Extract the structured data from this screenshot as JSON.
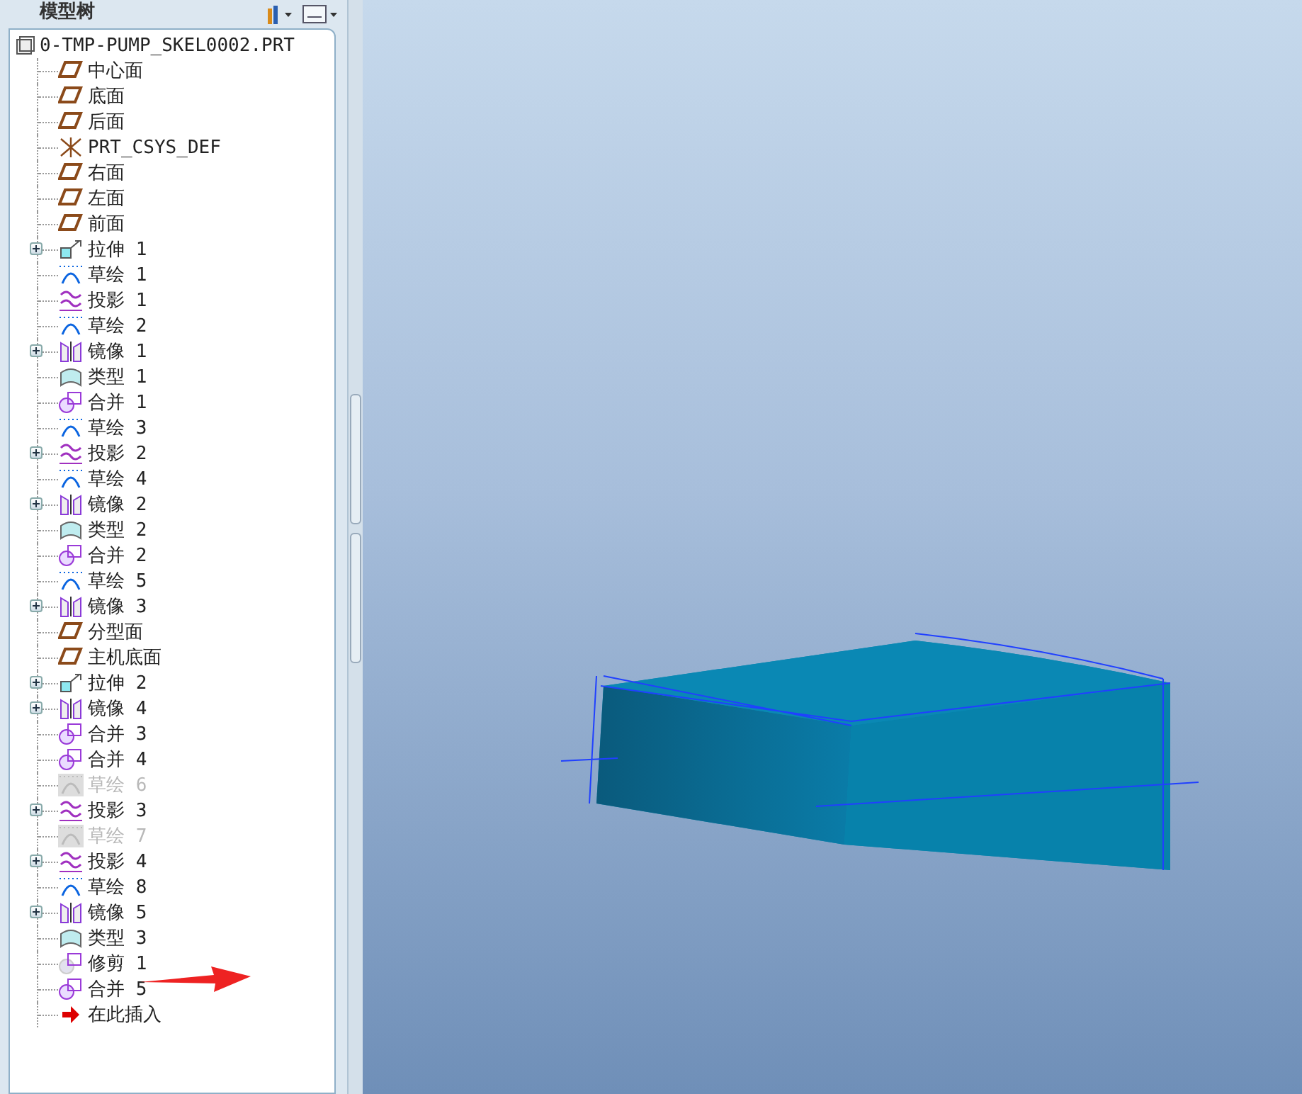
{
  "panel": {
    "title": "模型树"
  },
  "tree": {
    "root": {
      "label": "0-TMP-PUMP_SKEL0002.PRT"
    },
    "items": [
      {
        "kind": "plane",
        "label": "中心面",
        "collapsed": false,
        "suppressed": false
      },
      {
        "kind": "plane",
        "label": "底面",
        "collapsed": false,
        "suppressed": false
      },
      {
        "kind": "plane",
        "label": "后面",
        "collapsed": false,
        "suppressed": false
      },
      {
        "kind": "csys",
        "label": "PRT_CSYS_DEF",
        "collapsed": false,
        "suppressed": false
      },
      {
        "kind": "plane",
        "label": "右面",
        "collapsed": false,
        "suppressed": false
      },
      {
        "kind": "plane",
        "label": "左面",
        "collapsed": false,
        "suppressed": false
      },
      {
        "kind": "plane",
        "label": "前面",
        "collapsed": false,
        "suppressed": false
      },
      {
        "kind": "extrude",
        "label": "拉伸 1",
        "collapsed": true,
        "suppressed": false
      },
      {
        "kind": "sketch",
        "label": "草绘 1",
        "collapsed": false,
        "suppressed": false
      },
      {
        "kind": "projection",
        "label": "投影 1",
        "collapsed": false,
        "suppressed": false
      },
      {
        "kind": "sketch",
        "label": "草绘 2",
        "collapsed": false,
        "suppressed": false
      },
      {
        "kind": "mirror",
        "label": "镜像 1",
        "collapsed": true,
        "suppressed": false
      },
      {
        "kind": "style",
        "label": "类型 1",
        "collapsed": false,
        "suppressed": false
      },
      {
        "kind": "merge",
        "label": "合并 1",
        "collapsed": false,
        "suppressed": false
      },
      {
        "kind": "sketch",
        "label": "草绘 3",
        "collapsed": false,
        "suppressed": false
      },
      {
        "kind": "projection",
        "label": "投影 2",
        "collapsed": true,
        "suppressed": false
      },
      {
        "kind": "sketch",
        "label": "草绘 4",
        "collapsed": false,
        "suppressed": false
      },
      {
        "kind": "mirror",
        "label": "镜像 2",
        "collapsed": true,
        "suppressed": false
      },
      {
        "kind": "style",
        "label": "类型 2",
        "collapsed": false,
        "suppressed": false
      },
      {
        "kind": "merge",
        "label": "合并 2",
        "collapsed": false,
        "suppressed": false
      },
      {
        "kind": "sketch",
        "label": "草绘 5",
        "collapsed": false,
        "suppressed": false
      },
      {
        "kind": "mirror",
        "label": "镜像 3",
        "collapsed": true,
        "suppressed": false
      },
      {
        "kind": "plane",
        "label": "分型面",
        "collapsed": false,
        "suppressed": false
      },
      {
        "kind": "plane",
        "label": "主机底面",
        "collapsed": false,
        "suppressed": false
      },
      {
        "kind": "extrude",
        "label": "拉伸 2",
        "collapsed": true,
        "suppressed": false
      },
      {
        "kind": "mirror",
        "label": "镜像 4",
        "collapsed": true,
        "suppressed": false
      },
      {
        "kind": "merge",
        "label": "合并 3",
        "collapsed": false,
        "suppressed": false
      },
      {
        "kind": "merge",
        "label": "合并 4",
        "collapsed": false,
        "suppressed": false
      },
      {
        "kind": "sketch",
        "label": "草绘 6",
        "collapsed": false,
        "suppressed": true
      },
      {
        "kind": "projection",
        "label": "投影 3",
        "collapsed": true,
        "suppressed": false
      },
      {
        "kind": "sketch",
        "label": "草绘 7",
        "collapsed": false,
        "suppressed": true
      },
      {
        "kind": "projection",
        "label": "投影 4",
        "collapsed": true,
        "suppressed": false
      },
      {
        "kind": "sketch",
        "label": "草绘 8",
        "collapsed": false,
        "suppressed": false
      },
      {
        "kind": "mirror",
        "label": "镜像 5",
        "collapsed": true,
        "suppressed": false
      },
      {
        "kind": "style",
        "label": "类型 3",
        "collapsed": false,
        "suppressed": false
      },
      {
        "kind": "trim",
        "label": "修剪 1",
        "collapsed": false,
        "suppressed": false
      },
      {
        "kind": "merge",
        "label": "合并 5",
        "collapsed": false,
        "suppressed": false
      },
      {
        "kind": "insert",
        "label": "在此插入",
        "collapsed": false,
        "suppressed": false
      }
    ]
  }
}
